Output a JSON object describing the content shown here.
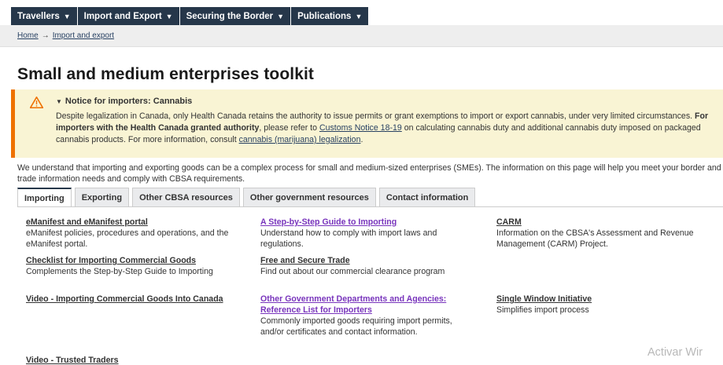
{
  "nav": {
    "items": [
      {
        "label": "Travellers"
      },
      {
        "label": "Import and Export"
      },
      {
        "label": "Securing the Border"
      },
      {
        "label": "Publications"
      }
    ]
  },
  "breadcrumb": {
    "home": "Home",
    "current": "Import and export"
  },
  "page": {
    "title": "Small and medium enterprises toolkit"
  },
  "notice": {
    "title": "Notice for importers: Cannabis",
    "text1": "Despite legalization in Canada, only Health Canada retains the authority to issue permits or grant exemptions to import or export cannabis, under very limited circumstances. ",
    "bold": "For importers with the Health Canada granted authority",
    "text2": ", please refer to ",
    "link1": "Customs Notice 18-19",
    "text3": " on calculating cannabis duty and additional cannabis duty imposed on packaged cannabis products. For more information, consult ",
    "link2": "cannabis (marijuana) legalization",
    "text4": "."
  },
  "intro": "We understand that importing and exporting goods can be a complex process for small and medium-sized enterprises (SMEs). The information on this page will help you meet your border and trade information needs and comply with CBSA requirements.",
  "tabs": [
    {
      "label": "Importing"
    },
    {
      "label": "Exporting"
    },
    {
      "label": "Other CBSA resources"
    },
    {
      "label": "Other government resources"
    },
    {
      "label": "Contact information"
    }
  ],
  "links": [
    {
      "title": "eManifest and eManifest portal",
      "desc": "eManifest policies, procedures and operations, and the eManifest portal."
    },
    {
      "title": "A Step-by-Step Guide to Importing",
      "desc": "Understand how to comply with import laws and regulations."
    },
    {
      "title": "CARM",
      "desc": "Information on the CBSA's Assessment and Revenue Management (CARM) Project."
    },
    {
      "title": "Checklist for Importing Commercial Goods",
      "desc": "Complements the Step-by-Step Guide to Importing"
    },
    {
      "title": "Free and Secure Trade",
      "desc": "Find out about our commercial clearance program"
    },
    {
      "title": "Video - Importing Commercial Goods Into Canada",
      "desc": ""
    },
    {
      "title": "Other Government Departments and Agencies: Reference List for Importers",
      "desc": "Commonly imported goods requiring import permits, and/or certificates and contact information."
    },
    {
      "title": "Single Window Initiative",
      "desc": "Simplifies import process"
    },
    {
      "title": "Video - Trusted Traders",
      "desc": ""
    }
  ],
  "watermark": "Activar Wir",
  "colors": {
    "nav_bg": "#26374a",
    "notice_bg": "#f9f4d4",
    "notice_border": "#ee7100",
    "link": "#284162",
    "visited_link": "#7834bc"
  }
}
